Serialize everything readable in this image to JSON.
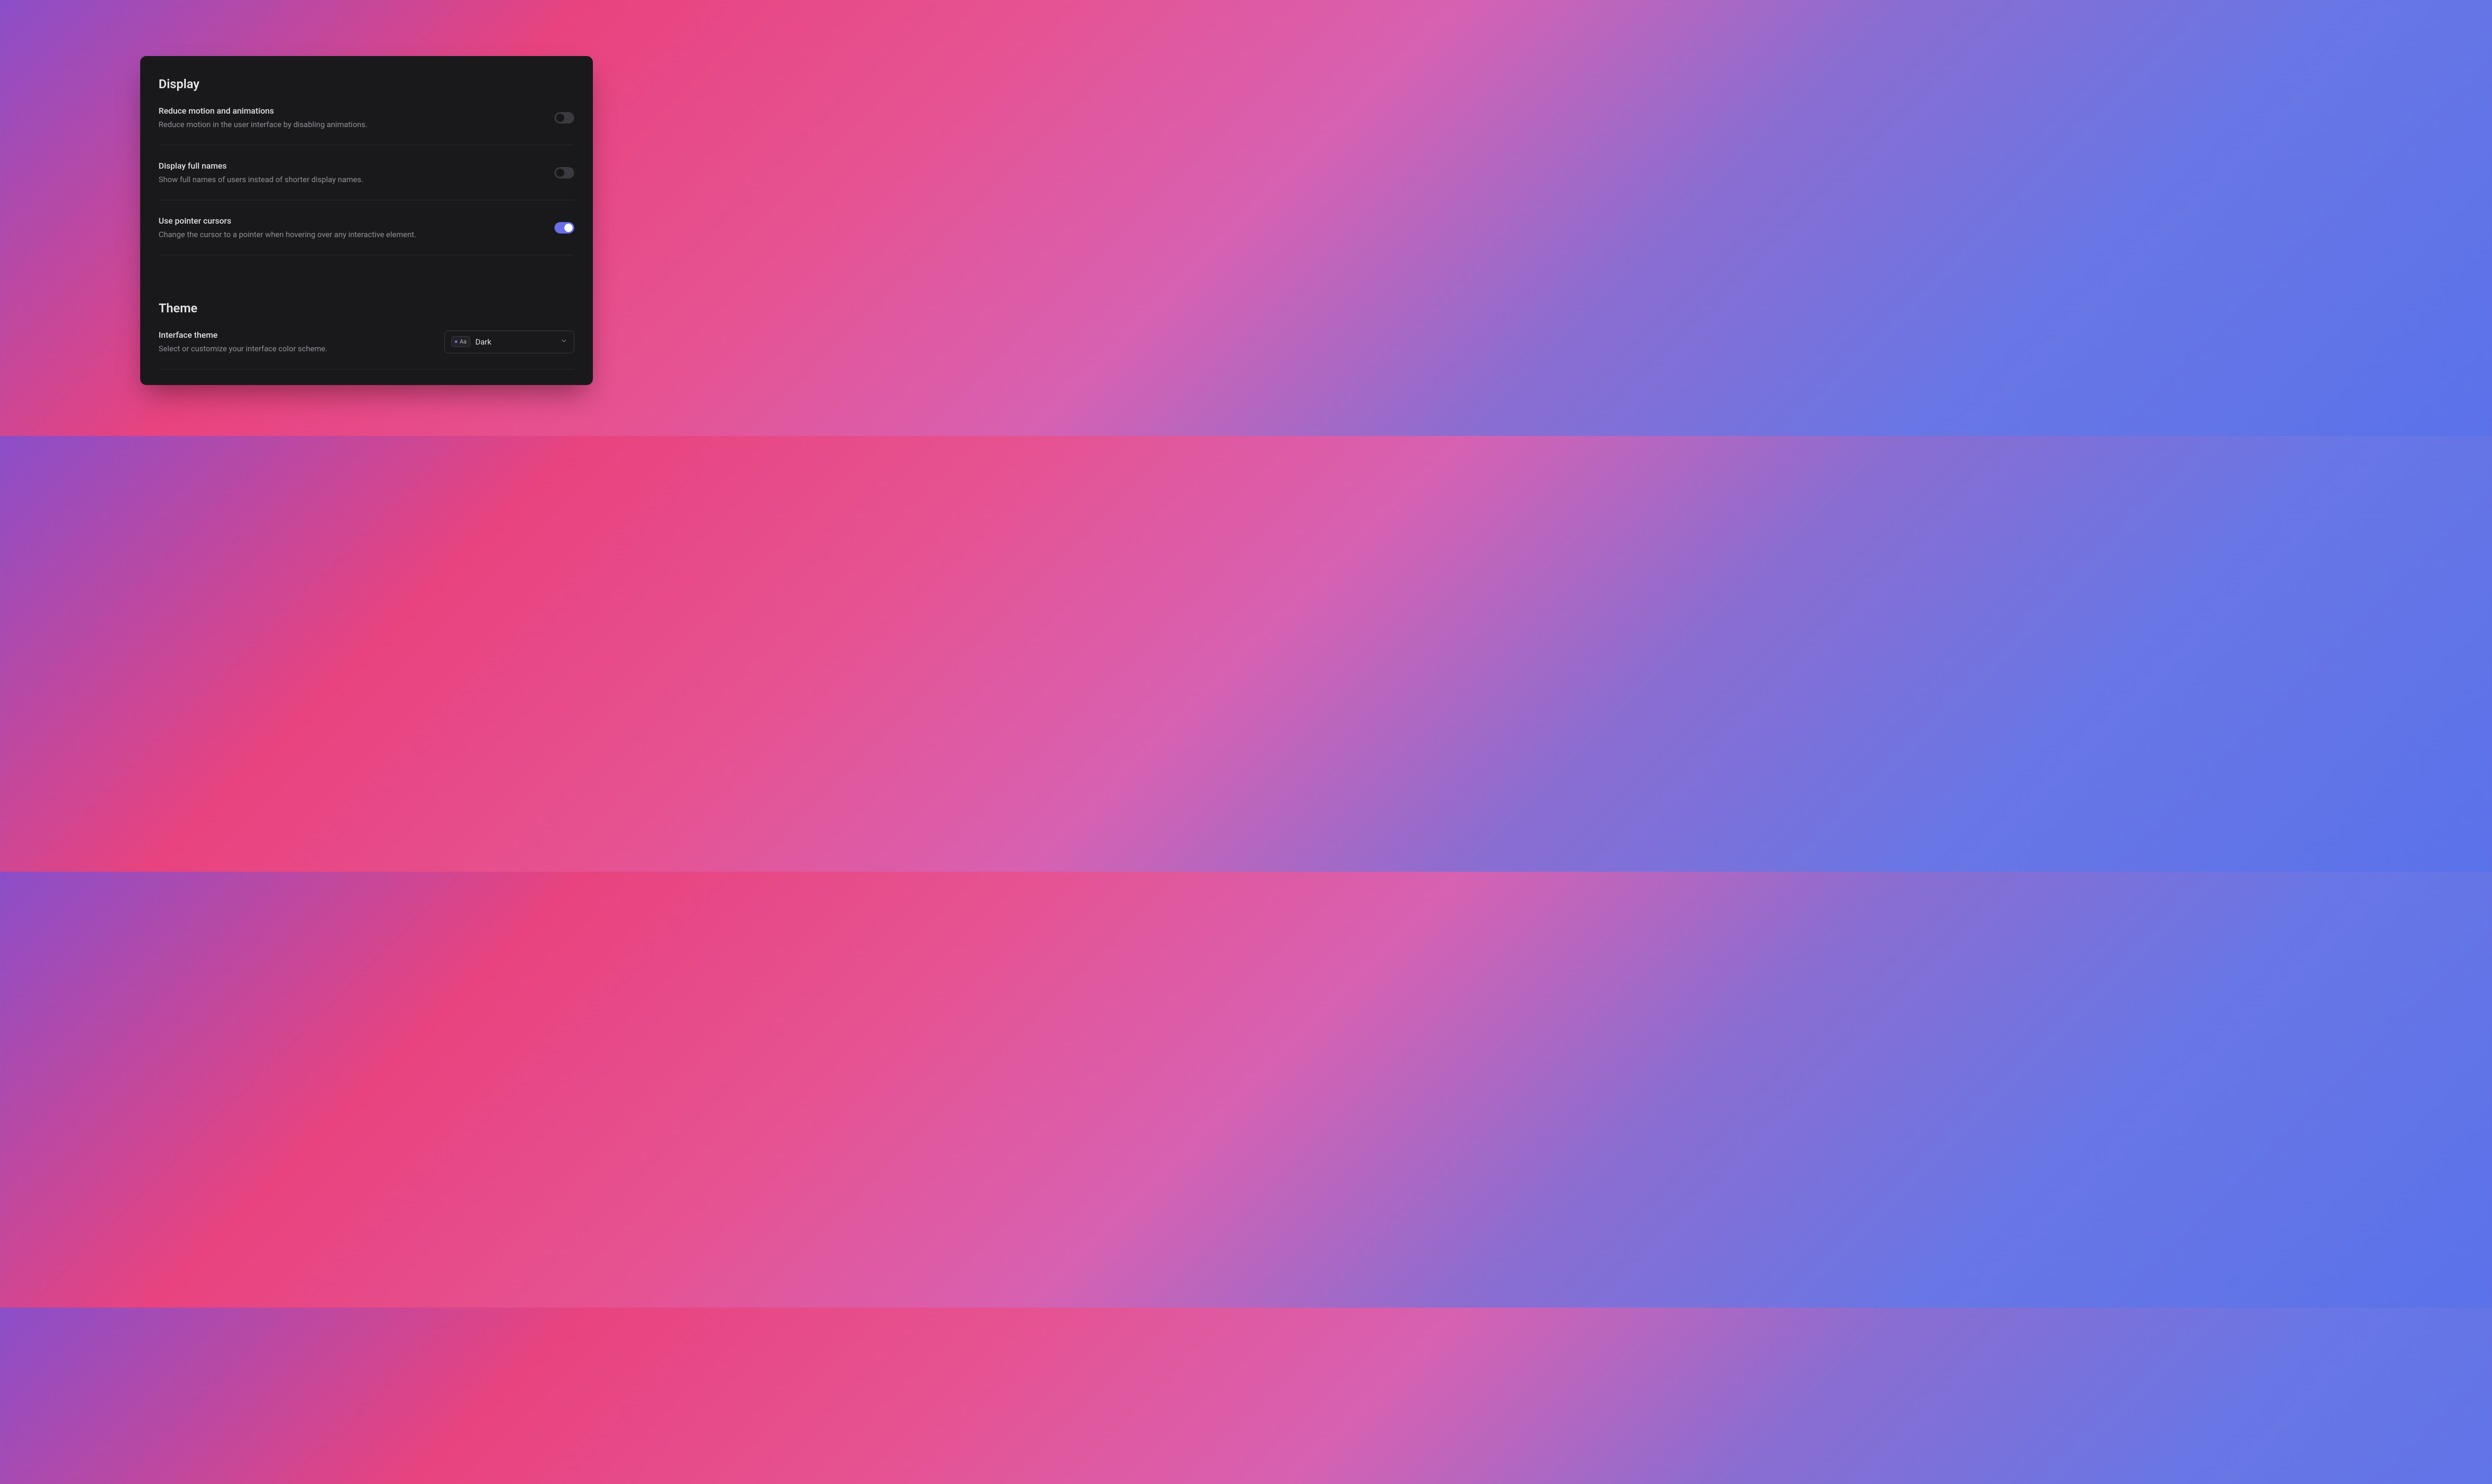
{
  "display": {
    "heading": "Display",
    "settings": [
      {
        "title": "Reduce motion and animations",
        "description": "Reduce motion in the user interface by disabling animations.",
        "enabled": false
      },
      {
        "title": "Display full names",
        "description": "Show full names of users instead of shorter display names.",
        "enabled": false
      },
      {
        "title": "Use pointer cursors",
        "description": "Change the cursor to a pointer when hovering over any interactive element.",
        "enabled": true
      }
    ]
  },
  "theme": {
    "heading": "Theme",
    "setting": {
      "title": "Interface theme",
      "description": "Select or customize your interface color scheme.",
      "preview_label": "Aa",
      "value": "Dark"
    }
  }
}
